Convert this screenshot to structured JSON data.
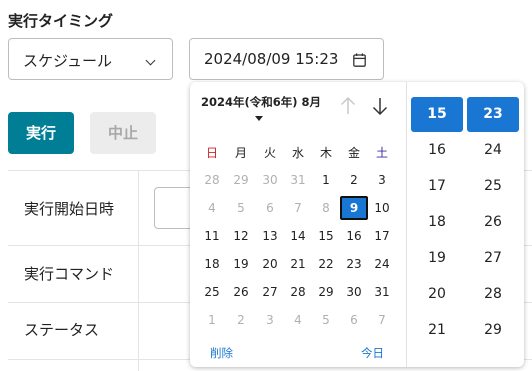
{
  "section_title": "実行タイミング",
  "schedule_select": {
    "value": "スケジュール"
  },
  "datetime_input": {
    "value": "2024/08/09 15:23",
    "icon": "calendar-icon"
  },
  "buttons": {
    "run": "実行",
    "stop": "中止"
  },
  "table": {
    "rows": [
      {
        "label": "実行開始日時"
      },
      {
        "label": "実行コマンド"
      },
      {
        "label": "ステータス"
      }
    ]
  },
  "datepicker": {
    "month_label": "2024年(令和6年) 8月",
    "weekdays": [
      "日",
      "月",
      "火",
      "水",
      "木",
      "金",
      "土"
    ],
    "weeks": [
      [
        "28",
        "29",
        "30",
        "31",
        "1",
        "2",
        "3"
      ],
      [
        "4",
        "5",
        "6",
        "7",
        "8",
        "9",
        "10"
      ],
      [
        "11",
        "12",
        "13",
        "14",
        "15",
        "16",
        "17"
      ],
      [
        "18",
        "19",
        "20",
        "21",
        "22",
        "23",
        "24"
      ],
      [
        "25",
        "26",
        "27",
        "28",
        "29",
        "30",
        "31"
      ],
      [
        "1",
        "2",
        "3",
        "4",
        "5",
        "6",
        "7"
      ]
    ],
    "selected_day": "9",
    "clear_label": "削除",
    "today_label": "今日",
    "hours": [
      "15",
      "16",
      "17",
      "18",
      "19",
      "20",
      "21"
    ],
    "minutes": [
      "23",
      "24",
      "25",
      "26",
      "27",
      "28",
      "29"
    ],
    "selected_hour": "15",
    "selected_minute": "23"
  },
  "colors": {
    "accent": "#007e96",
    "selection": "#1976d2",
    "sunday": "#c62828",
    "saturday": "#3a2fa0"
  }
}
